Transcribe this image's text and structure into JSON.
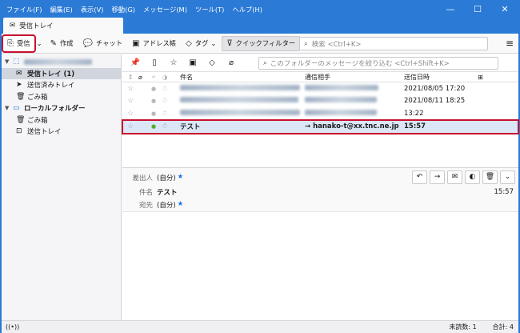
{
  "menu": [
    "ファイル(F)",
    "編集(E)",
    "表示(V)",
    "移動(G)",
    "メッセージ(M)",
    "ツール(T)",
    "ヘルプ(H)"
  ],
  "window_controls": {
    "minimize": "—",
    "maximize": "☐",
    "close": "✕"
  },
  "tab": {
    "label": "受信トレイ"
  },
  "toolbar": {
    "get_mail": "受信",
    "compose": "作成",
    "chat": "チャット",
    "address_book": "アドレス帳",
    "tag": "タグ",
    "quick_filter": "クイックフィルター",
    "search_placeholder": "検索 <Ctrl+K>"
  },
  "folders": {
    "account_items": [
      {
        "label": "受信トレイ (1)"
      },
      {
        "label": "送信済みトレイ"
      },
      {
        "label": "ごみ箱"
      }
    ],
    "local_label": "ローカルフォルダー",
    "local_items": [
      {
        "label": "ごみ箱"
      },
      {
        "label": "送信トレイ"
      }
    ]
  },
  "filter": {
    "placeholder": "このフォルダーのメッセージを絞り込む <Ctrl+Shift+K>"
  },
  "columns": {
    "subject": "件名",
    "correspondent": "通信相手",
    "date": "送信日時"
  },
  "messages": [
    {
      "date": "2021/08/05 17:20"
    },
    {
      "date": "2021/08/11 18:25"
    },
    {
      "date": "13:22"
    },
    {
      "subject": "テスト",
      "correspondent": "hanako-t@xx.tnc.ne.jp",
      "date": "15:57"
    }
  ],
  "preview": {
    "from_label": "差出人",
    "from_value": "(自分)",
    "subject_label": "件名",
    "subject_value": "テスト",
    "to_label": "宛先",
    "to_value": "(自分)",
    "time": "15:57"
  },
  "status": {
    "unread": "未読数: 1",
    "total": "合計: 4"
  },
  "colors": {
    "titlebar": "#2a7ad6",
    "highlight": "#c8102e",
    "selected_row": "#dbe7f6"
  }
}
